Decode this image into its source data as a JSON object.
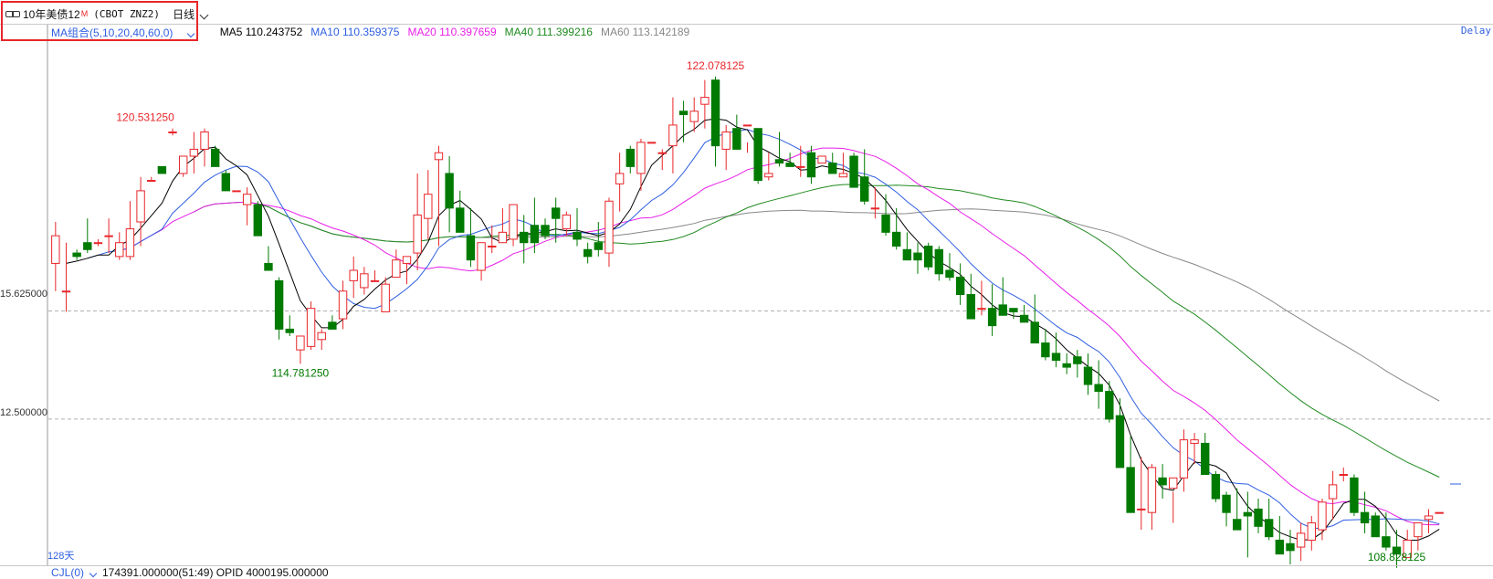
{
  "header": {
    "symbol_name": "10年美债12",
    "symbol_sup": "M",
    "symbol_code": "(CBOT ZNZ2)",
    "period": "日线"
  },
  "indicators": {
    "selector": "MA组合(5,10,20,40,60,0)",
    "ma5": "MA5 110.243752",
    "ma10": "MA10 110.359375",
    "ma20": "MA20 110.397659",
    "ma40": "MA40 111.399216",
    "ma60": "MA60 113.142189"
  },
  "delay_label": "Delay",
  "y_axis": {
    "label_1": "15.625000",
    "label_2": "12.500000"
  },
  "annotations": {
    "high_main": "122.078125",
    "high_left": "120.531250",
    "low_left": "114.781250",
    "low_right": "108.828125"
  },
  "days_label": "128天",
  "bottom": {
    "cjl": "CJL(0)",
    "volume_info": "174391.000000(51:49)  OPID 4000195.000000"
  },
  "colors": {
    "up": "#e8262a",
    "down": "#007a00",
    "ma5": "#000000",
    "ma10": "#2f5fe0",
    "ma20": "#e81fe8",
    "ma40": "#1f8a1f",
    "ma60": "#888888",
    "grid": "#b0b0b0"
  },
  "chart_data": {
    "type": "candlestick",
    "title": "10年美债12 (CBOT ZNZ2) 日线",
    "candles": [
      [
        117.0,
        118.2,
        116.2,
        117.8
      ],
      [
        116.2,
        117.6,
        115.6,
        116.2
      ],
      [
        117.3,
        117.4,
        117.1,
        117.2
      ],
      [
        117.6,
        118.3,
        117.3,
        117.4
      ],
      [
        117.6,
        117.7,
        117.5,
        117.6
      ],
      [
        117.8,
        118.3,
        117.3,
        117.8
      ],
      [
        117.2,
        117.9,
        117.1,
        117.6
      ],
      [
        117.2,
        118.8,
        117.1,
        118.0
      ],
      [
        118.2,
        119.5,
        117.5,
        119.1
      ],
      [
        119.4,
        119.5,
        119.4,
        119.4
      ],
      [
        119.8,
        119.8,
        119.6,
        119.6
      ],
      [
        120.8,
        120.9,
        120.7,
        120.8
      ],
      [
        119.6,
        120.1,
        119.5,
        120.1
      ],
      [
        120.1,
        120.8,
        119.6,
        120.3
      ],
      [
        120.3,
        120.9,
        119.8,
        120.8
      ],
      [
        120.3,
        120.4,
        119.8,
        119.8
      ],
      [
        119.6,
        119.7,
        119.1,
        119.1
      ],
      [
        119.1,
        119.1,
        119.1,
        119.1
      ],
      [
        118.7,
        119.2,
        118.1,
        119.0
      ],
      [
        118.7,
        118.8,
        117.8,
        117.8
      ],
      [
        117.0,
        117.5,
        116.8,
        116.8
      ],
      [
        116.5,
        116.6,
        114.8,
        115.1
      ],
      [
        115.1,
        115.5,
        114.9,
        115.0
      ],
      [
        114.5,
        114.9,
        114.1,
        114.9
      ],
      [
        114.6,
        115.9,
        114.5,
        115.7
      ],
      [
        114.8,
        115.1,
        114.5,
        115.0
      ],
      [
        115.3,
        115.5,
        115.1,
        115.1
      ],
      [
        115.4,
        116.5,
        115.1,
        116.2
      ],
      [
        116.5,
        117.2,
        116.0,
        116.8
      ],
      [
        116.3,
        116.9,
        116.1,
        116.7
      ],
      [
        116.5,
        116.8,
        116.5,
        116.5
      ],
      [
        115.6,
        116.6,
        115.6,
        116.4
      ],
      [
        116.6,
        117.4,
        116.6,
        117.1
      ],
      [
        117.0,
        117.2,
        116.4,
        117.2
      ],
      [
        117.3,
        119.6,
        116.8,
        118.4
      ],
      [
        118.3,
        119.7,
        117.7,
        119.0
      ],
      [
        120.0,
        120.4,
        117.5,
        120.2
      ],
      [
        119.6,
        120.1,
        117.9,
        118.6
      ],
      [
        118.6,
        119.1,
        117.9,
        117.9
      ],
      [
        117.8,
        118.6,
        116.9,
        117.1
      ],
      [
        116.8,
        117.6,
        116.5,
        117.6
      ],
      [
        117.5,
        118.1,
        117.3,
        117.5
      ],
      [
        117.6,
        118.6,
        117.6,
        117.9
      ],
      [
        117.7,
        118.7,
        117.5,
        118.7
      ],
      [
        117.9,
        118.4,
        117.0,
        117.6
      ],
      [
        118.1,
        118.9,
        117.3,
        117.6
      ],
      [
        118.1,
        118.3,
        117.7,
        117.8
      ],
      [
        118.6,
        118.9,
        117.6,
        118.3
      ],
      [
        118.0,
        118.5,
        117.8,
        118.4
      ],
      [
        117.9,
        118.6,
        117.5,
        117.7
      ],
      [
        117.4,
        117.6,
        117.0,
        117.2
      ],
      [
        117.6,
        118.2,
        117.2,
        117.4
      ],
      [
        117.3,
        118.9,
        116.9,
        118.8
      ],
      [
        119.3,
        120.2,
        118.5,
        119.6
      ],
      [
        120.3,
        120.4,
        119.6,
        119.8
      ],
      [
        119.6,
        120.6,
        119.1,
        120.5
      ],
      [
        120.5,
        120.5,
        120.5,
        120.5
      ],
      [
        120.2,
        120.3,
        119.7,
        120.2
      ],
      [
        120.4,
        121.8,
        119.6,
        121.0
      ],
      [
        121.4,
        121.7,
        120.5,
        121.3
      ],
      [
        121.1,
        121.8,
        120.8,
        121.4
      ],
      [
        121.6,
        122.3,
        120.9,
        121.8
      ],
      [
        122.3,
        122.4,
        119.8,
        120.4
      ],
      [
        120.3,
        121.0,
        119.7,
        120.8
      ],
      [
        120.9,
        121.3,
        120.3,
        120.3
      ],
      [
        121.0,
        120.5,
        120.2,
        121.0
      ],
      [
        120.9,
        120.9,
        119.3,
        119.4
      ],
      [
        119.5,
        120.2,
        119.4,
        119.6
      ],
      [
        120.0,
        120.8,
        119.8,
        119.9
      ],
      [
        119.9,
        120.2,
        119.9,
        119.8
      ],
      [
        119.8,
        120.4,
        119.5,
        119.8
      ],
      [
        120.2,
        120.4,
        119.3,
        119.5
      ],
      [
        119.9,
        120.1,
        119.9,
        120.1
      ],
      [
        119.9,
        120.2,
        119.6,
        119.6
      ],
      [
        119.5,
        120.2,
        119.5,
        119.6
      ],
      [
        120.1,
        120.2,
        119.2,
        119.2
      ],
      [
        119.5,
        120.3,
        118.7,
        118.8
      ],
      [
        118.6,
        119.2,
        118.3,
        118.6
      ],
      [
        118.4,
        119.0,
        117.8,
        117.9
      ],
      [
        117.9,
        118.6,
        117.4,
        117.5
      ],
      [
        117.4,
        117.9,
        117.1,
        117.1
      ],
      [
        117.3,
        117.6,
        116.7,
        117.1
      ],
      [
        117.5,
        117.6,
        116.8,
        116.9
      ],
      [
        117.4,
        117.5,
        116.5,
        116.7
      ],
      [
        116.8,
        117.3,
        116.5,
        116.6
      ],
      [
        116.6,
        117.0,
        115.8,
        116.1
      ],
      [
        116.1,
        116.7,
        115.6,
        115.4
      ],
      [
        115.7,
        116.5,
        115.5,
        115.7
      ],
      [
        115.7,
        116.4,
        114.9,
        115.2
      ],
      [
        115.8,
        116.6,
        115.5,
        115.5
      ],
      [
        115.7,
        115.7,
        115.4,
        115.6
      ],
      [
        115.5,
        115.8,
        115.4,
        115.3
      ],
      [
        115.3,
        116.1,
        114.7,
        114.7
      ],
      [
        114.7,
        115.1,
        114.2,
        114.3
      ],
      [
        114.4,
        115.0,
        114.0,
        114.2
      ],
      [
        114.1,
        114.4,
        113.8,
        114.0
      ],
      [
        114.3,
        114.5,
        113.7,
        114.1
      ],
      [
        114.0,
        114.4,
        113.2,
        113.5
      ],
      [
        113.5,
        114.2,
        112.8,
        113.3
      ],
      [
        113.3,
        113.6,
        112.4,
        112.5
      ],
      [
        112.6,
        113.1,
        111.8,
        111.1
      ],
      [
        111.1,
        112.0,
        110.0,
        109.8
      ],
      [
        109.9,
        111.4,
        109.3,
        109.9
      ],
      [
        109.8,
        111.2,
        109.3,
        111.1
      ],
      [
        110.8,
        111.2,
        110.2,
        110.6
      ],
      [
        110.5,
        110.4,
        109.5,
        110.8
      ],
      [
        110.8,
        112.2,
        110.4,
        111.9
      ],
      [
        111.8,
        112.1,
        111.2,
        111.9
      ],
      [
        111.8,
        112.1,
        111.0,
        110.9
      ],
      [
        110.9,
        111.0,
        110.1,
        110.2
      ],
      [
        110.3,
        110.4,
        109.4,
        109.8
      ],
      [
        109.6,
        110.5,
        109.6,
        109.3
      ],
      [
        109.8,
        110.4,
        108.5,
        109.7
      ],
      [
        109.9,
        110.2,
        109.2,
        109.4
      ],
      [
        109.6,
        110.2,
        109.0,
        109.1
      ],
      [
        109.0,
        109.7,
        108.6,
        108.6
      ],
      [
        108.9,
        109.3,
        108.3,
        108.7
      ],
      [
        108.8,
        109.5,
        108.4,
        109.2
      ],
      [
        109.0,
        109.7,
        108.7,
        109.5
      ],
      [
        109.3,
        110.2,
        109.0,
        110.1
      ],
      [
        110.2,
        111.0,
        109.6,
        110.6
      ],
      [
        110.9,
        111.1,
        110.7,
        110.9
      ],
      [
        110.8,
        110.9,
        109.7,
        109.8
      ],
      [
        109.8,
        110.4,
        109.2,
        109.5
      ],
      [
        109.7,
        109.8,
        109.4,
        109.1
      ],
      [
        109.1,
        109.8,
        108.7,
        108.8
      ],
      [
        108.8,
        109.3,
        108.2,
        108.6
      ],
      [
        108.5,
        109.3,
        108.5,
        109.0
      ],
      [
        109.1,
        109.5,
        108.7,
        109.5
      ],
      [
        109.6,
        109.9,
        109.2,
        109.7
      ],
      [
        109.8,
        109.8,
        109.8,
        109.8
      ]
    ],
    "ylim": [
      108.3,
      123.4
    ],
    "grid_levels": [
      115.625,
      112.5
    ],
    "grid": true
  }
}
